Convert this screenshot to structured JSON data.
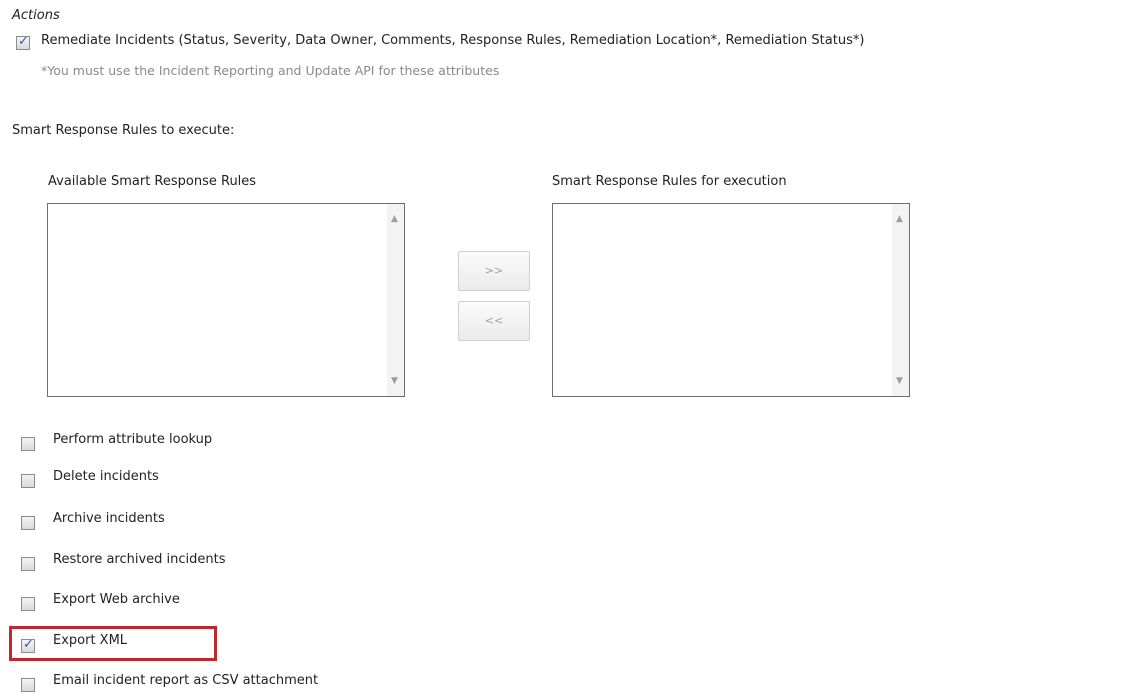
{
  "section_title": "Actions",
  "remediate": {
    "label": "Remediate Incidents (Status, Severity, Data Owner, Comments, Response Rules, Remediation Location*, Remediation Status*)",
    "checked": true,
    "note": "*You must use the Incident Reporting and Update API for these attributes"
  },
  "smart_rules": {
    "heading": "Smart Response Rules to execute:",
    "available_label": "Available Smart Response Rules",
    "execution_label": "Smart Response Rules for execution",
    "add_label": ">>",
    "remove_label": "<<"
  },
  "options": [
    {
      "label": "Perform attribute lookup",
      "checked": false
    },
    {
      "label": "Delete incidents",
      "checked": false
    },
    {
      "label": "Archive incidents",
      "checked": false
    },
    {
      "label": "Restore archived incidents",
      "checked": false
    },
    {
      "label": "Export Web archive",
      "checked": false
    },
    {
      "label": "Export XML",
      "checked": true,
      "highlighted": true
    },
    {
      "label": "Email incident report as CSV attachment",
      "checked": false
    }
  ],
  "colors": {
    "highlight": "#c1272d",
    "check": "#2f55b4"
  }
}
